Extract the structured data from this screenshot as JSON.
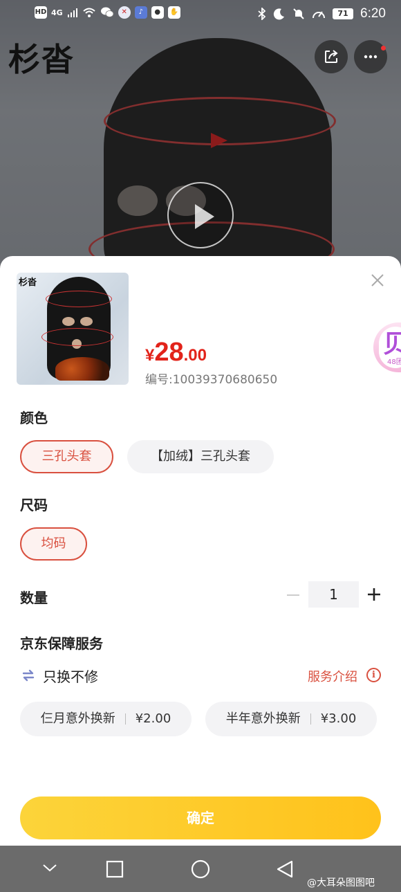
{
  "status_bar": {
    "time": "6:20",
    "battery": "71",
    "network_badge": "HD",
    "signal_text": "4G"
  },
  "background_page": {
    "brand_title": "杉沓"
  },
  "sheet": {
    "thumbnail_brand": "杉沓",
    "price": {
      "currency": "¥",
      "integer": "28",
      "decimal": ".00"
    },
    "sku": "编号:10039370680650",
    "side_badge_text": "贝",
    "side_badge_small": "48团",
    "color_section": {
      "title": "颜色",
      "options": [
        {
          "label": "三孔头套",
          "selected": true
        },
        {
          "label": "【加绒】三孔头套",
          "selected": false
        }
      ]
    },
    "size_section": {
      "title": "尺码",
      "options": [
        {
          "label": "均码",
          "selected": true
        }
      ]
    },
    "quantity_section": {
      "title": "数量",
      "value": "1"
    },
    "service_section": {
      "title": "京东保障服务",
      "service_name": "只换不修",
      "service_link": "服务介绍",
      "info_glyph": "i",
      "plans": [
        {
          "name": "仨月意外换新",
          "price": "¥2.00"
        },
        {
          "name": "半年意外换新",
          "price": "¥3.00"
        }
      ]
    },
    "confirm_label": "确定"
  },
  "watermark": "@大耳朵图图吧",
  "colors": {
    "accent_red": "#d9503f",
    "price_red": "#e2231a",
    "confirm_yellow": "#fcd43a"
  }
}
